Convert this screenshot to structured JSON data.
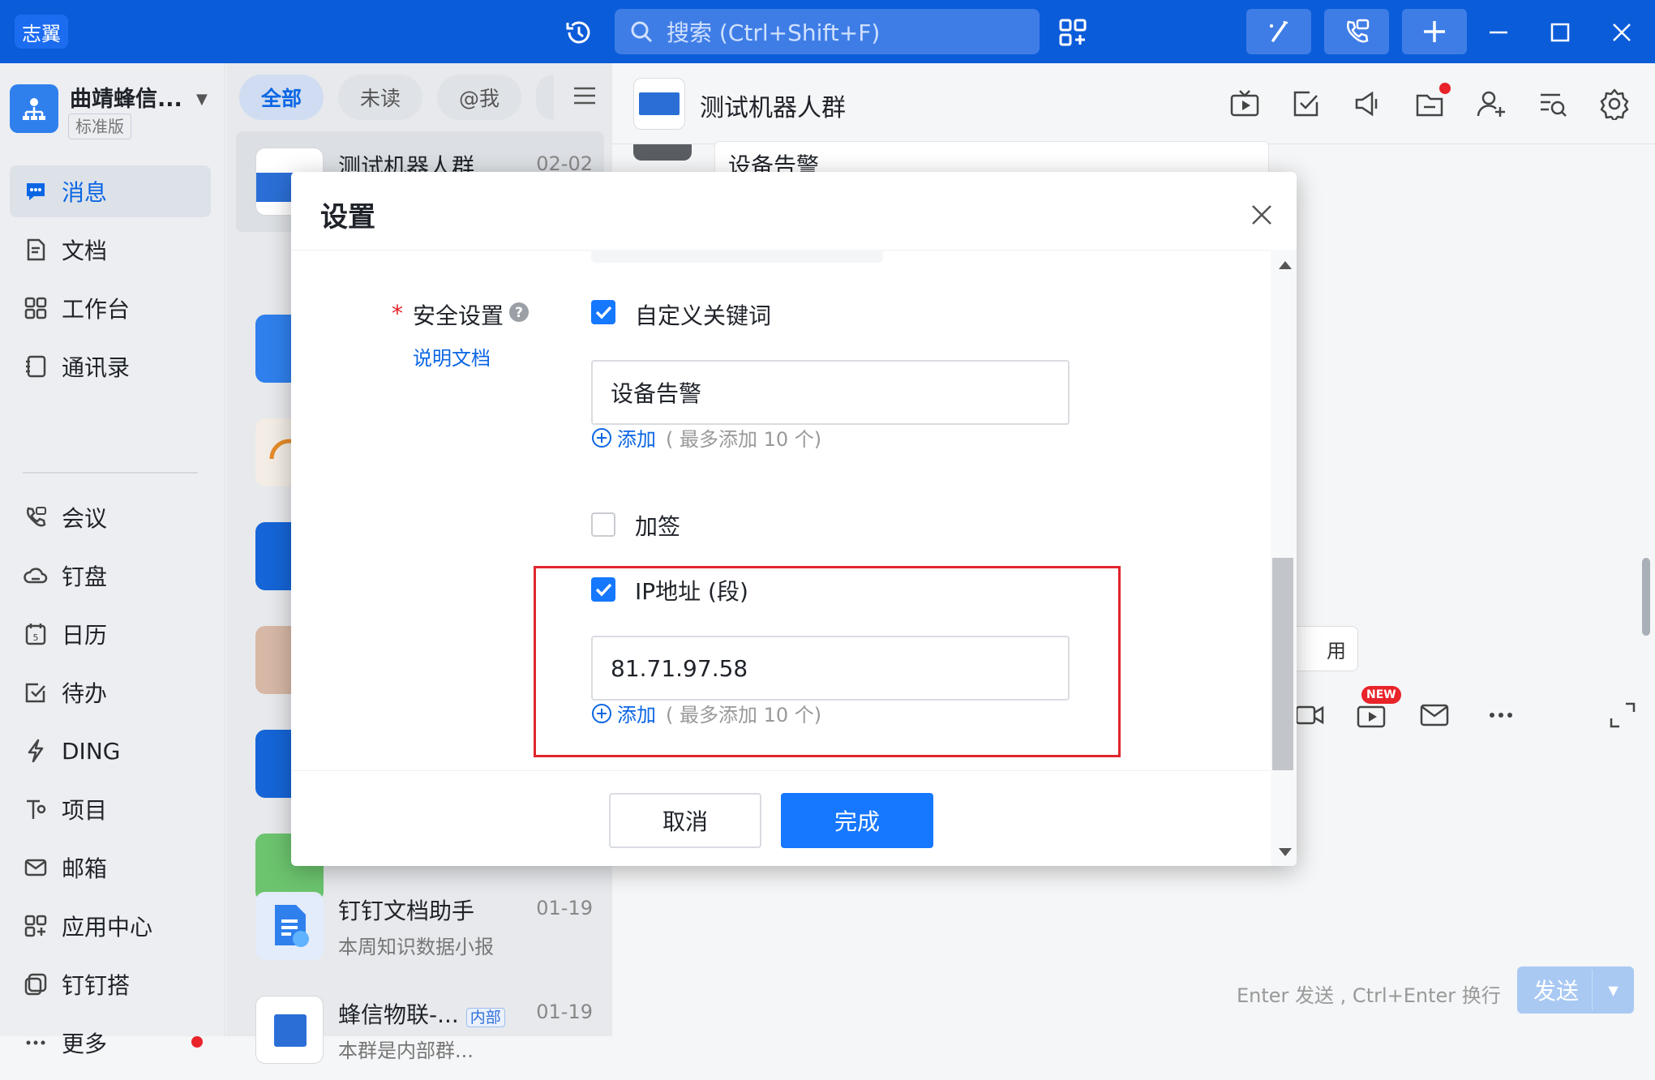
{
  "app": {
    "logo_text": "志翼",
    "search_placeholder": "搜索 (Ctrl+Shift+F)"
  },
  "org": {
    "name": "曲靖蜂信...",
    "edition": "标准版"
  },
  "nav": {
    "items": [
      {
        "label": "消息",
        "icon": "message-icon"
      },
      {
        "label": "文档",
        "icon": "doc-icon"
      },
      {
        "label": "工作台",
        "icon": "workbench-icon"
      },
      {
        "label": "通讯录",
        "icon": "contacts-icon"
      },
      {
        "label": "会议",
        "icon": "meeting-icon"
      },
      {
        "label": "钉盘",
        "icon": "cloud-drive-icon"
      },
      {
        "label": "日历",
        "icon": "calendar-icon"
      },
      {
        "label": "待办",
        "icon": "todo-icon"
      },
      {
        "label": "DING",
        "icon": "ding-icon"
      },
      {
        "label": "项目",
        "icon": "project-icon"
      },
      {
        "label": "邮箱",
        "icon": "mail-icon"
      },
      {
        "label": "应用中心",
        "icon": "app-center-icon"
      },
      {
        "label": "钉钉搭",
        "icon": "dingda-icon"
      },
      {
        "label": "更多",
        "icon": "more-icon"
      }
    ]
  },
  "list": {
    "filters": [
      "全部",
      "未读",
      "@我"
    ],
    "conversations": [
      {
        "name": "测试机器人群",
        "time": "02-02",
        "sub": ""
      },
      {
        "name": "钉钉文档助手",
        "time": "01-19",
        "sub": "本周知识数据小报"
      },
      {
        "name": "蜂信物联-...",
        "tag": "内部",
        "time": "01-19",
        "sub": "本群是内部群..."
      }
    ]
  },
  "chat": {
    "title": "测试机器人群",
    "last_message": "设备告警",
    "use_label": "用",
    "new_badge": "NEW",
    "enter_hint": "Enter 发送 , Ctrl+Enter 换行",
    "send_label": "发送"
  },
  "modal": {
    "title": "设置",
    "security_label": "安全设置",
    "doc_link": "说明文档",
    "keyword_option": "自定义关键词",
    "keyword_checked": true,
    "keyword_value": "设备告警",
    "add_label": "添加",
    "add_note": "( 最多添加 10 个)",
    "sign_option": "加签",
    "sign_checked": false,
    "ip_option": "IP地址 (段)",
    "ip_checked": true,
    "ip_value": "81.71.97.58",
    "cancel_label": "取消",
    "done_label": "完成"
  },
  "colors": {
    "topbar": "#0b5cd9",
    "accent": "#1677ff",
    "highlight": "#e1262d"
  }
}
